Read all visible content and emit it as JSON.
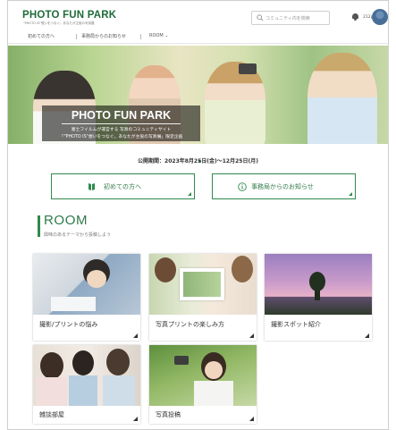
{
  "header": {
    "logo": "PHOTO FUN PARK",
    "tagline": "\"PHOTO IS\"想いをつなぐ。あなたが主役の写真展",
    "search_placeholder": "コミュニティ内を検索",
    "username": "212pt"
  },
  "nav": {
    "items": [
      {
        "label": "初めての方へ"
      },
      {
        "label": "事務局からのお知らせ"
      },
      {
        "label": "ROOM ⌄"
      }
    ]
  },
  "hero": {
    "title": "PHOTO FUN PARK",
    "subtitle_1": "富士フイルムが運営する 写真のコミュニティサイト",
    "subtitle_2": "「\"PHOTO IS\"想いをつなぐ。あなたが主役の写真展」限定企画"
  },
  "carousel": {
    "active_index": 0,
    "count": 2
  },
  "period": "公開期間：2023年8月25日(金)〜12月25日(月)",
  "cta": {
    "beginners": "初めての方へ",
    "notice": "事務局からのお知らせ"
  },
  "room": {
    "title": "ROOM",
    "subtitle": "興味のあるテーマから投稿しよう",
    "cards": [
      {
        "label": "撮影/プリントの悩み"
      },
      {
        "label": "写真プリントの楽しみ方"
      },
      {
        "label": "撮影スポット紹介"
      },
      {
        "label": "雑談部屋"
      },
      {
        "label": "写真投稿"
      }
    ]
  },
  "colors": {
    "brand_green": "#2f8a4e",
    "logo_green": "#1f6b3a",
    "dot_active": "#2f8a4e",
    "dot_inactive": "#cccccc"
  }
}
